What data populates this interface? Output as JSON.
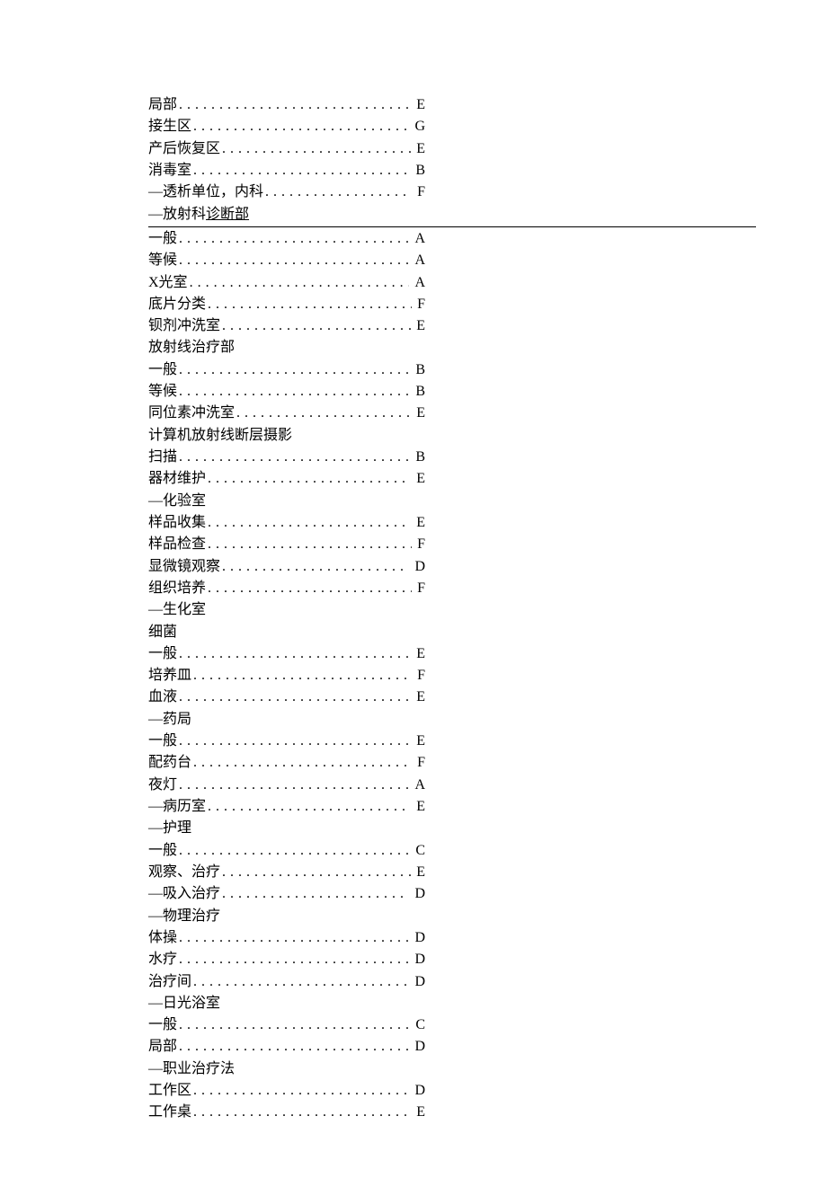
{
  "sections": [
    {
      "type": "entry",
      "label": "局部",
      "value": "E"
    },
    {
      "type": "entry",
      "label": "接生区",
      "value": "G"
    },
    {
      "type": "entry",
      "label": "产后恢复区",
      "value": "E"
    },
    {
      "type": "entry",
      "label": "消毒室",
      "value": "B"
    },
    {
      "type": "entry",
      "label": "―透析单位，内科",
      "value": "F"
    },
    {
      "type": "underlined",
      "part1": "―放射科 ",
      "part2": "诊断部"
    },
    {
      "type": "entry",
      "label": "一般",
      "value": "A"
    },
    {
      "type": "entry",
      "label": "等候",
      "value": "A"
    },
    {
      "type": "entry",
      "label": "X光室",
      "value": "A"
    },
    {
      "type": "entry",
      "label": "底片分类",
      "value": "F"
    },
    {
      "type": "entry",
      "label": "钡剂冲洗室",
      "value": "E"
    },
    {
      "type": "heading",
      "label": "放射线治疗部"
    },
    {
      "type": "entry",
      "label": "一般",
      "value": "B"
    },
    {
      "type": "entry",
      "label": "等候",
      "value": "B"
    },
    {
      "type": "entry",
      "label": "同位素冲洗室",
      "value": "E"
    },
    {
      "type": "heading",
      "label": "计算机放射线断层摄影"
    },
    {
      "type": "entry",
      "label": "扫描",
      "value": "B"
    },
    {
      "type": "entry",
      "label": "器材维护",
      "value": "E"
    },
    {
      "type": "heading",
      "label": "―化验室"
    },
    {
      "type": "entry",
      "label": "样品收集",
      "value": "E"
    },
    {
      "type": "entry",
      "label": "样品检查",
      "value": "F"
    },
    {
      "type": "entry",
      "label": "显微镜观察",
      "value": "D"
    },
    {
      "type": "entry",
      "label": "组织培养",
      "value": "F"
    },
    {
      "type": "heading",
      "label": "―生化室"
    },
    {
      "type": "heading",
      "label": "细菌"
    },
    {
      "type": "entry",
      "label": "一般",
      "value": "E"
    },
    {
      "type": "entry",
      "label": "培养皿",
      "value": "F"
    },
    {
      "type": "entry",
      "label": "血液",
      "value": "E"
    },
    {
      "type": "heading",
      "label": "―药局"
    },
    {
      "type": "entry",
      "label": "一般",
      "value": "E"
    },
    {
      "type": "entry",
      "label": "配药台",
      "value": "F"
    },
    {
      "type": "entry",
      "label": "夜灯",
      "value": "A"
    },
    {
      "type": "entry",
      "label": "―病历室",
      "value": "E"
    },
    {
      "type": "heading",
      "label": "―护理"
    },
    {
      "type": "entry",
      "label": "一般",
      "value": "C"
    },
    {
      "type": "entry",
      "label": "观察、治疗",
      "value": "E"
    },
    {
      "type": "entry",
      "label": "―吸入治疗",
      "value": "D"
    },
    {
      "type": "heading",
      "label": "―物理治疗"
    },
    {
      "type": "entry",
      "label": "体操",
      "value": "D"
    },
    {
      "type": "entry",
      "label": "水疗",
      "value": "D"
    },
    {
      "type": "entry",
      "label": "治疗间",
      "value": "D"
    },
    {
      "type": "heading",
      "label": "―日光浴室"
    },
    {
      "type": "entry",
      "label": "一般",
      "value": "C"
    },
    {
      "type": "entry",
      "label": "局部",
      "value": "D"
    },
    {
      "type": "heading",
      "label": "―职业治疗法"
    },
    {
      "type": "entry",
      "label": "工作区",
      "value": "D"
    },
    {
      "type": "entry",
      "label": "工作桌",
      "value": "E"
    }
  ]
}
